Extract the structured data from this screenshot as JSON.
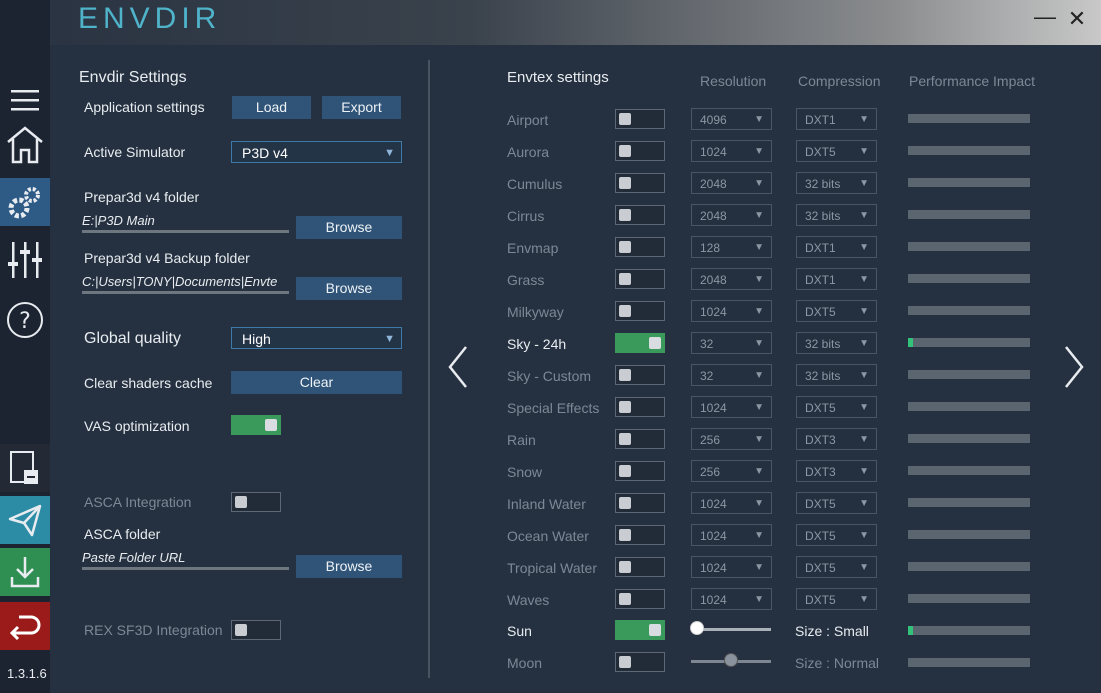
{
  "app": {
    "logo": "ENVDIR",
    "version": "1.3.1.6"
  },
  "window": {
    "minimize_glyph": "—",
    "close_glyph": "✕"
  },
  "sidebar": {
    "icons": [
      "menu-icon",
      "home-icon",
      "settings-gear-icon",
      "sliders-icon",
      "help-icon",
      "save-file-icon",
      "send-icon",
      "download-icon",
      "undo-icon"
    ],
    "accent_colors": {
      "gear": "#2e5b86",
      "send": "#2d8ca5",
      "download": "#2f8f52",
      "undo": "#9b1a1a"
    }
  },
  "left": {
    "section_title": "Envdir Settings",
    "app_settings_label": "Application settings",
    "load_label": "Load",
    "export_label": "Export",
    "active_sim_label": "Active Simulator",
    "active_sim_value": "P3D v4",
    "p3d_folder_label": "Prepar3d v4 folder",
    "p3d_folder_value": "E:|P3D Main",
    "browse_label": "Browse",
    "backup_folder_label": "Prepar3d v4 Backup folder",
    "backup_folder_value": "C:|Users|TONY|Documents|Envte",
    "global_quality_label": "Global quality",
    "global_quality_value": "High",
    "clear_cache_label": "Clear shaders cache",
    "clear_label": "Clear",
    "vas_label": "VAS optimization",
    "asca_integration_label": "ASCA Integration",
    "asca_folder_label": "ASCA folder",
    "asca_folder_placeholder": "Paste Folder URL",
    "rex_label": "REX SF3D Integration"
  },
  "right": {
    "section_title": "Envtex settings",
    "col_resolution": "Resolution",
    "col_compression": "Compression",
    "col_performance": "Performance Impact",
    "rows": [
      {
        "name": "Airport",
        "on": false,
        "res": "4096",
        "comp": "DXT1",
        "impact": 0
      },
      {
        "name": "Aurora",
        "on": false,
        "res": "1024",
        "comp": "DXT5",
        "impact": 0
      },
      {
        "name": "Cumulus",
        "on": false,
        "res": "2048",
        "comp": "32 bits",
        "impact": 0
      },
      {
        "name": "Cirrus",
        "on": false,
        "res": "2048",
        "comp": "32 bits",
        "impact": 0
      },
      {
        "name": "Envmap",
        "on": false,
        "res": "128",
        "comp": "DXT1",
        "impact": 0
      },
      {
        "name": "Grass",
        "on": false,
        "res": "2048",
        "comp": "DXT1",
        "impact": 0
      },
      {
        "name": "Milkyway",
        "on": false,
        "res": "1024",
        "comp": "DXT5",
        "impact": 0
      },
      {
        "name": "Sky - 24h",
        "on": true,
        "res": "32",
        "comp": "32 bits",
        "impact": 0.04
      },
      {
        "name": "Sky - Custom",
        "on": false,
        "res": "32",
        "comp": "32 bits",
        "impact": 0
      },
      {
        "name": "Special Effects",
        "on": false,
        "res": "1024",
        "comp": "DXT5",
        "impact": 0
      },
      {
        "name": "Rain",
        "on": false,
        "res": "256",
        "comp": "DXT3",
        "impact": 0
      },
      {
        "name": "Snow",
        "on": false,
        "res": "256",
        "comp": "DXT3",
        "impact": 0
      },
      {
        "name": "Inland Water",
        "on": false,
        "res": "1024",
        "comp": "DXT5",
        "impact": 0
      },
      {
        "name": "Ocean Water",
        "on": false,
        "res": "1024",
        "comp": "DXT5",
        "impact": 0
      },
      {
        "name": "Tropical Water",
        "on": false,
        "res": "1024",
        "comp": "DXT5",
        "impact": 0
      },
      {
        "name": "Waves",
        "on": false,
        "res": "1024",
        "comp": "DXT5",
        "impact": 0
      }
    ],
    "sun": {
      "name": "Sun",
      "on": true,
      "size_label": "Size : Small",
      "slider_level": 0.05,
      "impact": 0.04
    },
    "moon": {
      "name": "Moon",
      "on": false,
      "size_label": "Size : Normal",
      "slider_level": 0.5,
      "impact": 0
    },
    "prev_glyph": "〈",
    "next_glyph": "〉"
  }
}
